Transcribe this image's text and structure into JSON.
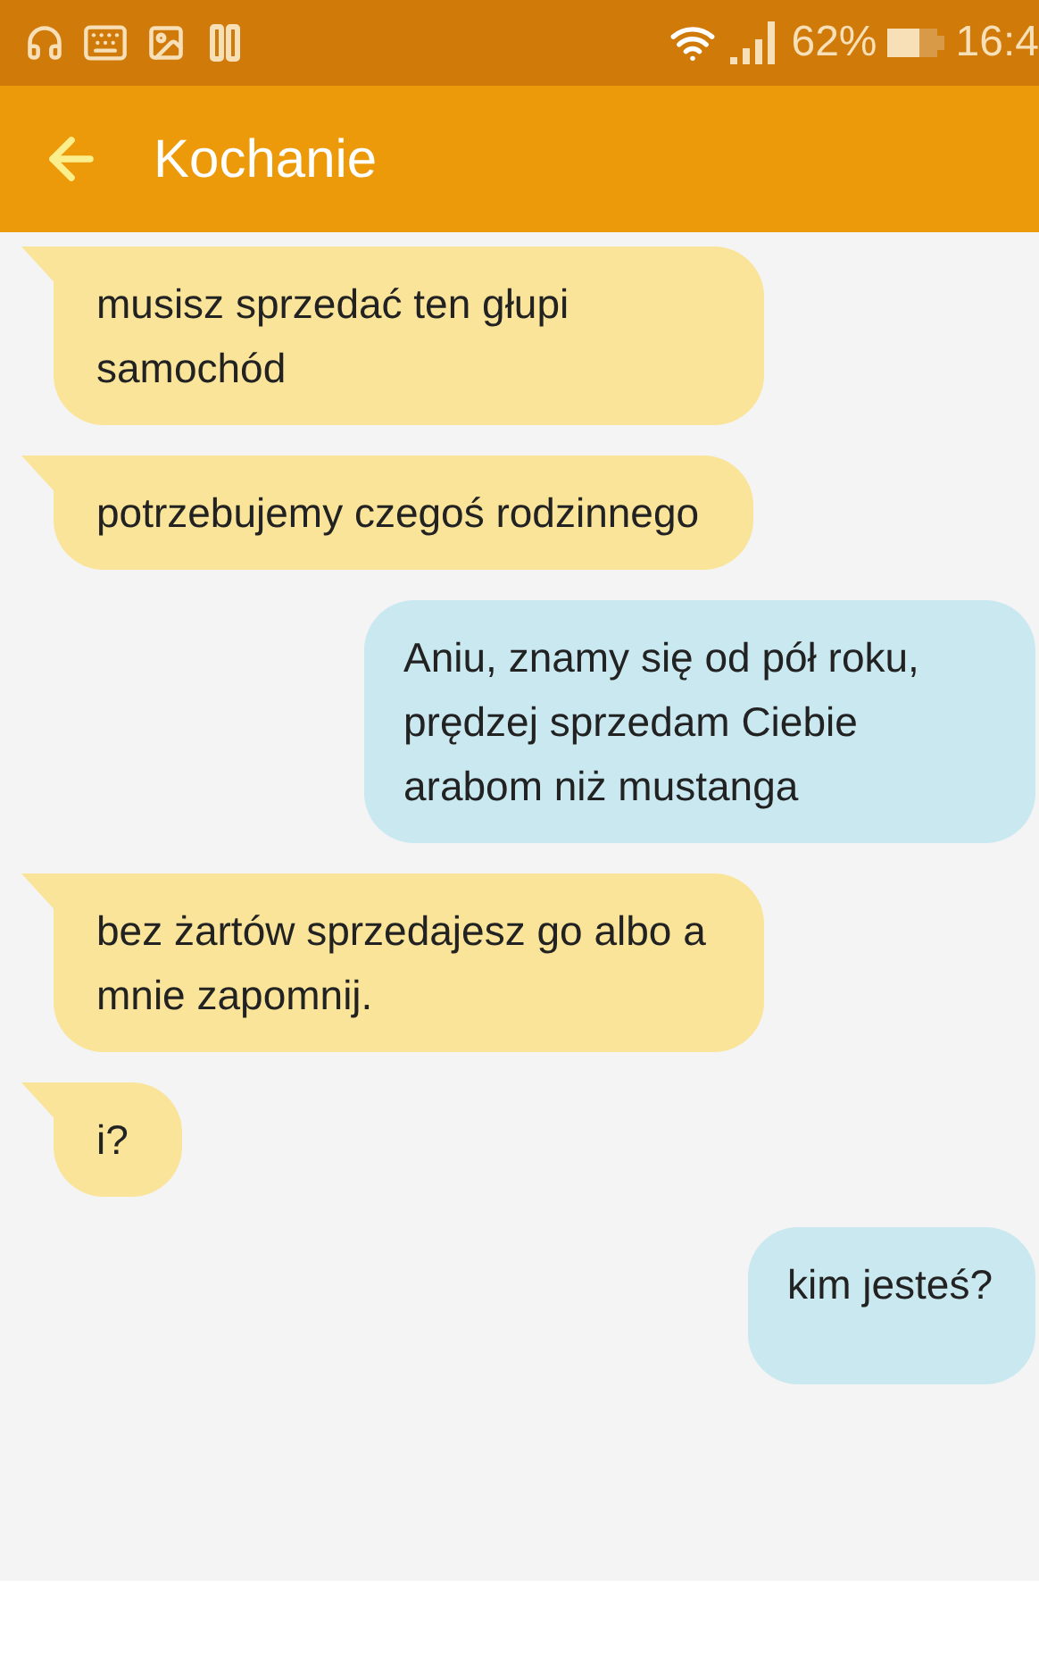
{
  "status_bar": {
    "battery": "62%",
    "time": "16:4"
  },
  "header": {
    "title": "Kochanie"
  },
  "messages": [
    {
      "kind": "incoming",
      "text": "musisz sprzedać ten głupi samochód"
    },
    {
      "kind": "incoming",
      "text": "potrzebujemy czegoś rodzinnego"
    },
    {
      "kind": "outgoing",
      "text": "Aniu, znamy się od pół roku, prędzej sprzedam Ciebie arabom niż mustanga"
    },
    {
      "kind": "incoming",
      "text": "bez żartów sprzedajesz go albo a mnie zapomnij."
    },
    {
      "kind": "incoming",
      "text": "i?"
    },
    {
      "kind": "outgoing",
      "text": "kim jesteś?"
    }
  ]
}
